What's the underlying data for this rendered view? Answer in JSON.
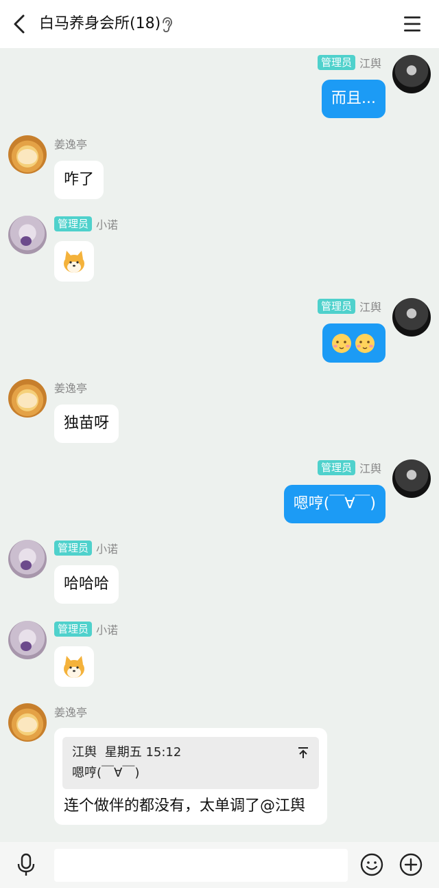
{
  "header": {
    "title": "白马养身会所(18)"
  },
  "roles": {
    "admin": "管理员"
  },
  "messages": [
    {
      "sender": "江舆",
      "admin": true,
      "text": "而且..."
    },
    {
      "sender": "姜逸亭",
      "admin": false,
      "text": "咋了"
    },
    {
      "sender": "小诺",
      "admin": true,
      "sticker": "shiba-sticker"
    },
    {
      "sender": "江舆",
      "admin": true,
      "sticker": "emoji-pair"
    },
    {
      "sender": "姜逸亭",
      "admin": false,
      "text": "独苗呀"
    },
    {
      "sender": "江舆",
      "admin": true,
      "text": "嗯哼(￣∀￣)"
    },
    {
      "sender": "小诺",
      "admin": true,
      "text": "哈哈哈"
    },
    {
      "sender": "小诺",
      "admin": true,
      "sticker": "shiba-sticker"
    },
    {
      "sender": "姜逸亭",
      "admin": false,
      "reply": {
        "author": "江舆",
        "time": "星期五 15:12",
        "text": "嗯哼(￣∀￣)"
      },
      "text": "连个做伴的都没有，太单调了@江舆"
    }
  ],
  "bottombar": {
    "input_placeholder": ""
  },
  "colors": {
    "accent": "#1c9bf5",
    "badge": "#4fd1cc",
    "background": "#edf1ee"
  }
}
